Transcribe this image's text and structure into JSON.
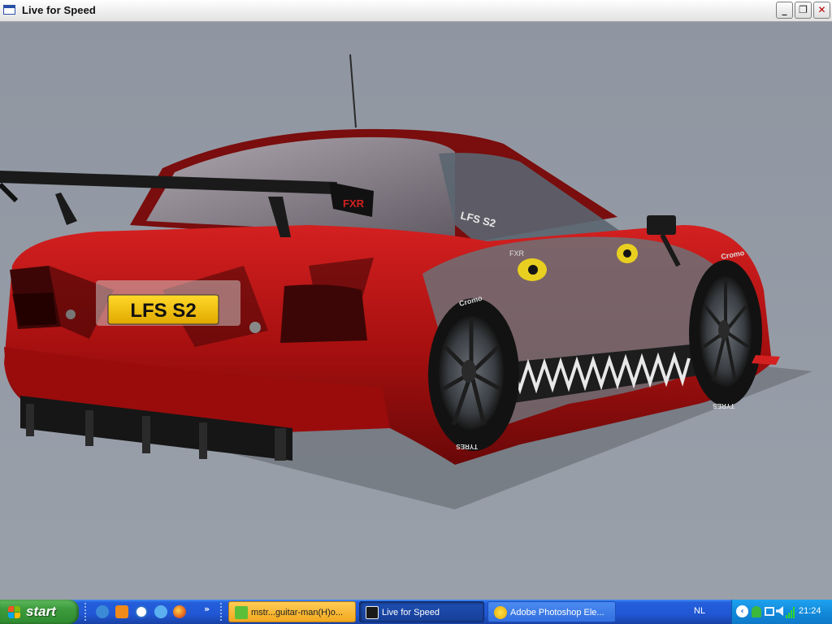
{
  "window": {
    "title": "Live for Speed",
    "icon": "app-window-icon",
    "controls": {
      "minimize": "_",
      "maximize": "❐",
      "close": "✕"
    }
  },
  "scene": {
    "plate_text": "LFS S2",
    "wing_logo": "FXR",
    "window_decal": "LFS S2",
    "side_decal": "FXR",
    "tyre_brand": "Cromo",
    "tyre_sidewall": "TYRES",
    "colors": {
      "background": "#9097a2",
      "livery_red": "#c01818",
      "plate_yellow": "#f5c400"
    }
  },
  "taskbar": {
    "start_label": "start",
    "quick_launch": [
      {
        "name": "ie-icon",
        "color": "#3a8ad8"
      },
      {
        "name": "alarm-icon",
        "color": "#f08a1a"
      },
      {
        "name": "media-player-icon",
        "color": "#ffffff"
      },
      {
        "name": "messenger-icon",
        "color": "#5ab0f0"
      },
      {
        "name": "firefox-icon",
        "color": "#e8641a"
      }
    ],
    "overflow_label": "»",
    "tasks": [
      {
        "label": "mstr...guitar-man(H)o...",
        "icon": "messenger-chat-icon",
        "state": "flashing"
      },
      {
        "label": "Live for Speed",
        "icon": "lfs-icon",
        "state": "active"
      },
      {
        "label": "Adobe Photoshop Ele...",
        "icon": "photoshop-elements-icon",
        "state": "normal"
      }
    ],
    "language": "NL",
    "tray_icons": [
      "messenger-tray-icon",
      "network-tray-icon",
      "volume-tray-icon",
      "signal-tray-icon"
    ],
    "clock": "21:24"
  }
}
